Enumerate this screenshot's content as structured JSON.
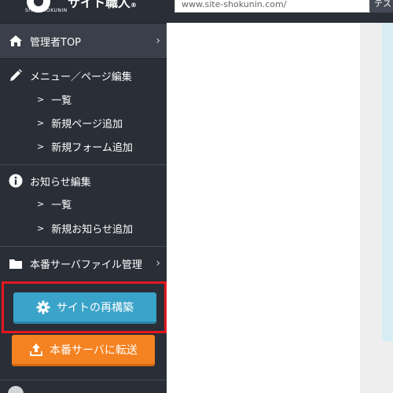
{
  "brand": {
    "name": "サイト職人",
    "sub": "SITE-SHOKUNIN",
    "mark": "®"
  },
  "topbar": {
    "url": "www.site-shokunin.com/",
    "test_button": "テス"
  },
  "sidebar": {
    "admin_top": "管理者TOP",
    "menu_edit": {
      "label": "メニュー／ページ編集",
      "items": [
        "一覧",
        "新規ページ追加",
        "新規フォーム追加"
      ]
    },
    "news_edit": {
      "label": "お知らせ編集",
      "items": [
        "一覧",
        "新規お知らせ追加"
      ]
    },
    "server_files": "本番サーバファイル管理",
    "rebuild_button": "サイトの再構築",
    "deploy_button": "本番サーバに転送"
  },
  "colors": {
    "sidebar_bg": "#2a2e37",
    "rebuild": "#3aa3c9",
    "deploy": "#f58220",
    "highlight": "#e4171f"
  },
  "icons": [
    "home-icon",
    "pencil-icon",
    "info-icon",
    "folder-icon",
    "gear-icon",
    "upload-icon",
    "chevron-right-icon"
  ]
}
